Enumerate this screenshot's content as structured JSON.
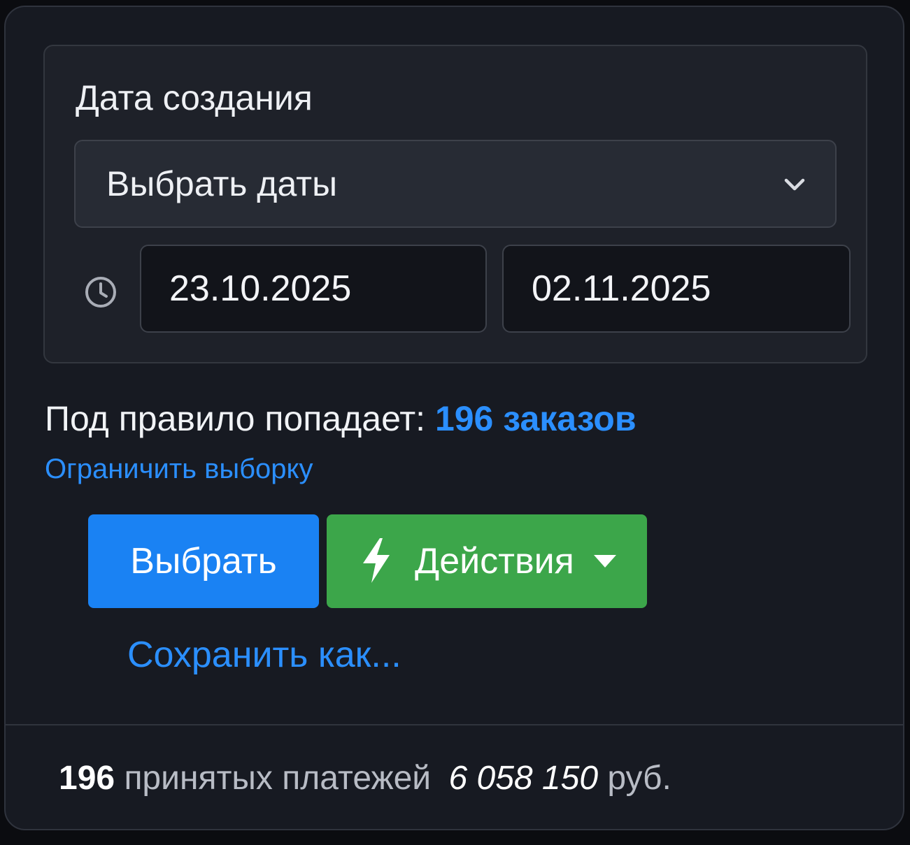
{
  "filter": {
    "label": "Дата создания",
    "select_value": "Выбрать даты",
    "date_from": "23.10.2025",
    "date_to": "02.11.2025"
  },
  "rule": {
    "prefix": "Под правило попадает:",
    "count_text": "196 заказов",
    "limit_link": "Ограничить выборку"
  },
  "buttons": {
    "select_label": "Выбрать",
    "actions_label": "Действия",
    "save_as_label": "Сохранить как..."
  },
  "footer": {
    "count": "196",
    "payments_text": "принятых платежей",
    "sum": "6 058 150",
    "currency": "руб."
  },
  "colors": {
    "accent_blue": "#2b8fff",
    "button_blue": "#1a82f3",
    "button_green": "#3ca64a",
    "panel_bg": "#171a22"
  },
  "icons": {
    "select": "chevron-down-icon",
    "date": "clock-icon",
    "actions": "lightning-bolt-icon",
    "actions_dropdown": "caret-down-icon"
  }
}
